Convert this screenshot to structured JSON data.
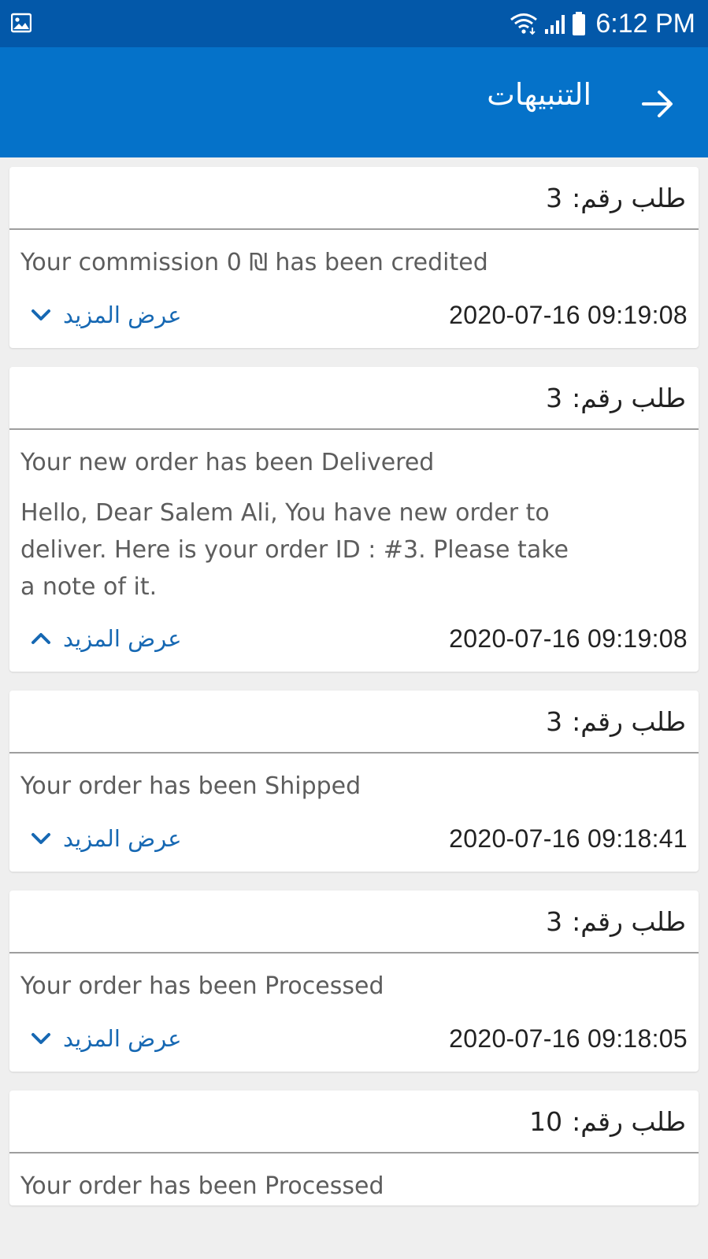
{
  "status_bar": {
    "time": "6:12 PM",
    "icons": [
      "image-icon",
      "wifi-icon",
      "signal-icon",
      "battery-icon"
    ]
  },
  "app_bar": {
    "title": "التنبيهات",
    "back_icon": "arrow-right-icon"
  },
  "colors": {
    "status_bar": "#0358a9",
    "app_bar": "#0572c9",
    "link": "#1668b3",
    "background": "#efefef"
  },
  "notifications": [
    {
      "order_label": "طلب رقم:",
      "order_number": "3",
      "title": "Your commission 0 ₪ has been credited",
      "body": "",
      "timestamp": "2020-07-16 09:19:08",
      "more_label": "عرض المزيد",
      "expanded": false
    },
    {
      "order_label": "طلب رقم:",
      "order_number": "3",
      "title": "Your new order has been Delivered",
      "body": "Hello, Dear Salem Ali, You have new order to deliver. Here is your order ID : #3. Please take a note of it.",
      "timestamp": "2020-07-16 09:19:08",
      "more_label": "عرض المزيد",
      "expanded": true
    },
    {
      "order_label": "طلب رقم:",
      "order_number": "3",
      "title": "Your order has been Shipped",
      "body": "",
      "timestamp": "2020-07-16 09:18:41",
      "more_label": "عرض المزيد",
      "expanded": false
    },
    {
      "order_label": "طلب رقم:",
      "order_number": "3",
      "title": "Your order has been Processed",
      "body": "",
      "timestamp": "2020-07-16 09:18:05",
      "more_label": "عرض المزيد",
      "expanded": false
    },
    {
      "order_label": "طلب رقم:",
      "order_number": "10",
      "title": "Your order has been Processed",
      "body": "",
      "timestamp": "",
      "more_label": "",
      "expanded": false
    }
  ]
}
